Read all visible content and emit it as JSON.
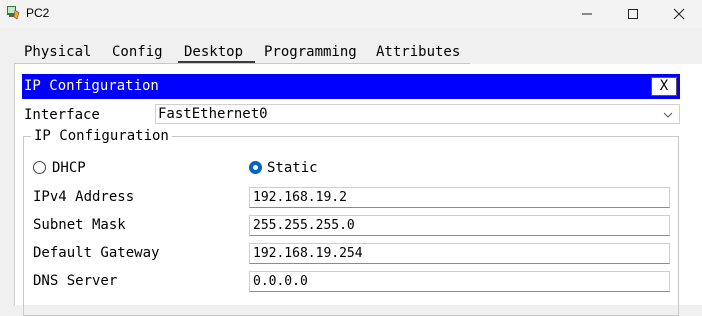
{
  "window": {
    "title": "PC2"
  },
  "tabs": [
    {
      "label": "Physical",
      "active": false
    },
    {
      "label": "Config",
      "active": false
    },
    {
      "label": "Desktop",
      "active": true
    },
    {
      "label": "Programming",
      "active": false
    },
    {
      "label": "Attributes",
      "active": false
    }
  ],
  "ip_config": {
    "header": "IP Configuration",
    "close_label": "X",
    "interface_label": "Interface",
    "interface_value": "FastEthernet0",
    "group_title": "IP Configuration",
    "dhcp_label": "DHCP",
    "static_label": "Static",
    "mode_selected": "Static",
    "fields": {
      "ipv4": {
        "label": "IPv4 Address",
        "value": "192.168.19.2"
      },
      "subnet": {
        "label": "Subnet Mask",
        "value": "255.255.255.0"
      },
      "gateway": {
        "label": "Default Gateway",
        "value": "192.168.19.254"
      },
      "dns": {
        "label": "DNS Server",
        "value": "0.0.0.0"
      }
    }
  },
  "colors": {
    "header_bg": "#0000ff",
    "radio_accent": "#0067c0"
  },
  "icons": {
    "app": "packet-tracer-pc-icon",
    "minimize": "minimize-icon",
    "maximize": "maximize-icon",
    "close": "close-icon"
  }
}
